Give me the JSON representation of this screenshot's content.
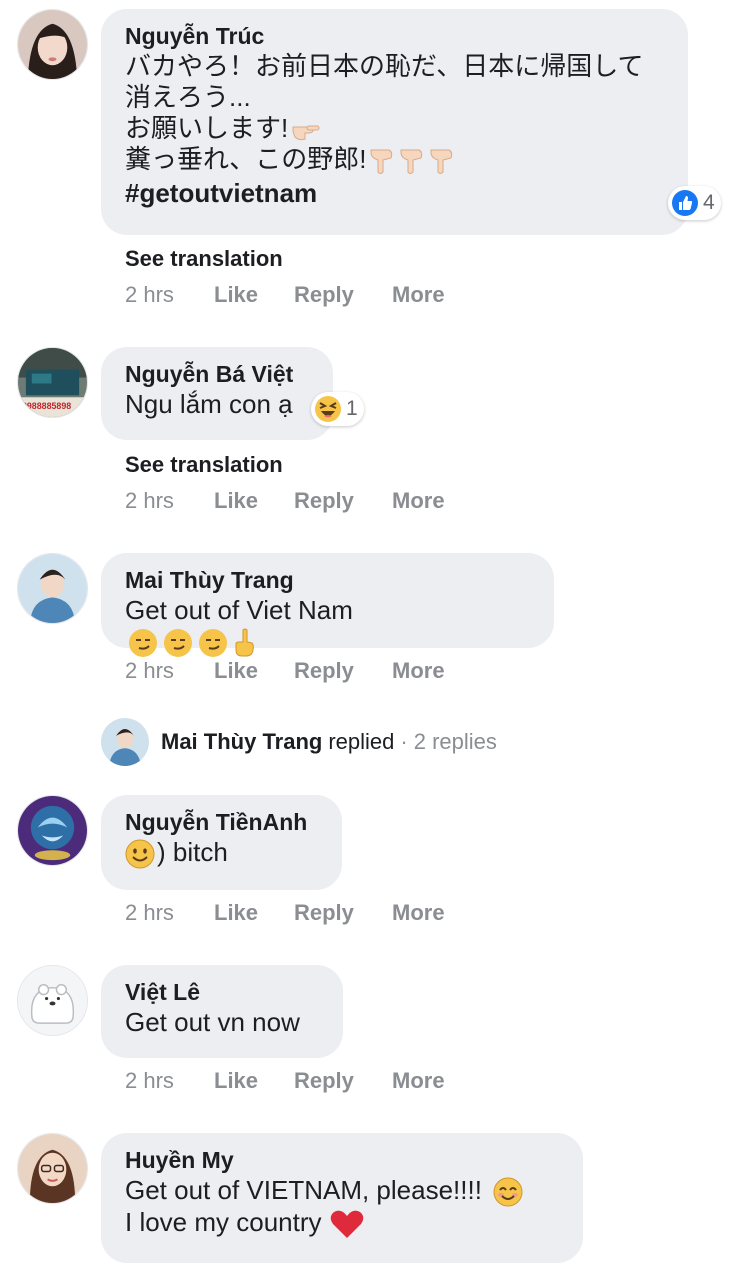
{
  "comments": [
    {
      "name": "Nguyễn Trúc",
      "text_line1": "バカやろ！お前日本の恥だ、日本に帰国して",
      "text_line2": "消えろう...",
      "text_line3": "お願いします!",
      "text_line4": "糞っ垂れ、この野郎!",
      "hashtag": "#getoutvietnam",
      "reaction": {
        "icon": "like-icon",
        "count": "4",
        "color": "#1877f2"
      },
      "see_translation": "See translation",
      "time": "2 hrs",
      "like": "Like",
      "reply": "Reply",
      "more": "More"
    },
    {
      "name": "Nguyễn Bá Việt",
      "text": "Ngu lắm con ạ",
      "reaction": {
        "icon": "haha-icon",
        "count": "1"
      },
      "see_translation": "See translation",
      "time": "2 hrs",
      "like": "Like",
      "reply": "Reply",
      "more": "More"
    },
    {
      "name": "Mai Thùy Trang",
      "text": "Get out of Viet Nam",
      "time": "2 hrs",
      "like": "Like",
      "reply": "Reply",
      "more": "More",
      "replied": {
        "name": "Mai Thùy Trang",
        "verb": "replied",
        "sep": "·",
        "count": "2 replies"
      }
    },
    {
      "name": "Nguyễn TiềnAnh",
      "text": ") bitch",
      "time": "2 hrs",
      "like": "Like",
      "reply": "Reply",
      "more": "More"
    },
    {
      "name": "Việt Lê",
      "text": "Get out vn now",
      "time": "2 hrs",
      "like": "Like",
      "reply": "Reply",
      "more": "More"
    },
    {
      "name": "Huyền My",
      "text_line1": "Get out of VIETNAM, please!!!!",
      "text_line2": "I love my country"
    }
  ]
}
